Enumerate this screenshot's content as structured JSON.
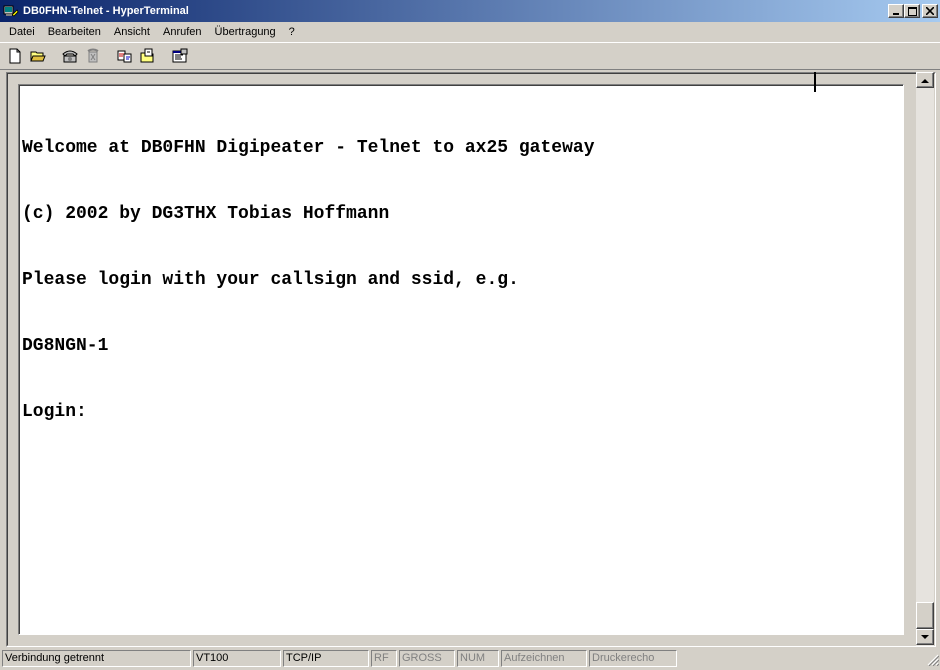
{
  "window": {
    "title": "DB0FHN-Telnet - HyperTerminal",
    "title_icon": "hyperterminal-icon",
    "buttons": [
      "minimize-icon",
      "maximize-icon",
      "close-icon"
    ]
  },
  "menu": {
    "items": [
      {
        "label": "Datei"
      },
      {
        "label": "Bearbeiten"
      },
      {
        "label": "Ansicht"
      },
      {
        "label": "Anrufen"
      },
      {
        "label": "Übertragung"
      },
      {
        "label": "?"
      }
    ]
  },
  "toolbar": {
    "buttons": [
      {
        "icon": "new-document-icon"
      },
      {
        "icon": "open-folder-icon"
      },
      {
        "icon": "call-phone-icon"
      },
      {
        "icon": "disconnect-phone-icon"
      },
      {
        "icon": "send-file-icon"
      },
      {
        "icon": "receive-file-icon"
      },
      {
        "icon": "properties-icon"
      }
    ]
  },
  "terminal": {
    "lines": [
      "Welcome at DB0FHN Digipeater - Telnet to ax25 gateway",
      "(c) 2002 by DG3THX Tobias Hoffmann",
      "Please login with your callsign and ssid, e.g.",
      "DG8NGN-1",
      "Login:"
    ]
  },
  "statusbar": {
    "connection": "Verbindung getrennt",
    "emulation": "VT100",
    "protocol": "TCP/IP",
    "rf": "RF",
    "gross": "GROSS",
    "num": "NUM",
    "capture": "Aufzeichnen",
    "printecho": "Druckerecho"
  },
  "colors": {
    "titlebar_start": "#0a246a",
    "titlebar_end": "#a6caf0",
    "chrome": "#d4d0c8",
    "terminal_bg": "#ffffff"
  }
}
